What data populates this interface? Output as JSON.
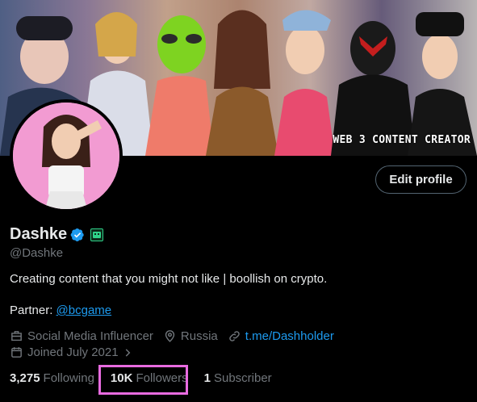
{
  "banner": {
    "tagline": "WEB 3 CONTENT CREATOR"
  },
  "profile": {
    "name": "Dashke",
    "handle": "@Dashke",
    "bio": "Creating content that you might not like | boollish on crypto.",
    "partner_label": "Partner:",
    "partner_link": "@bcgame",
    "category": "Social Media Influencer",
    "location": "Russia",
    "website": "t.me/Dashholder",
    "joined": "Joined July 2021"
  },
  "actions": {
    "edit_profile": "Edit profile"
  },
  "stats": {
    "following_count": "3,275",
    "following_label": "Following",
    "followers_count": "10K",
    "followers_label": "Followers",
    "subscribers_count": "1",
    "subscribers_label": "Subscriber"
  },
  "colors": {
    "accent": "#1d9bf0",
    "verified": "#1d9bf0",
    "highlight": "#e86be0",
    "muted": "#71767b"
  },
  "icons": [
    "verified-badge-icon",
    "affiliate-badge-icon",
    "briefcase-icon",
    "location-pin-icon",
    "link-icon",
    "calendar-icon",
    "chevron-right-icon"
  ]
}
